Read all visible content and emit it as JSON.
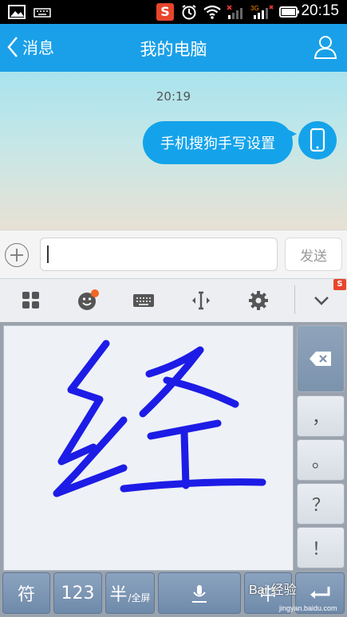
{
  "status_bar": {
    "time": "20:15",
    "icons": [
      "image-icon",
      "keyboard-icon",
      "sogou-icon",
      "alarm-icon",
      "wifi-icon",
      "signal-icon",
      "signal-3g-icon",
      "battery-icon"
    ]
  },
  "header": {
    "back_label": "消息",
    "title": "我的电脑"
  },
  "chat": {
    "timestamp": "20:19",
    "messages": [
      {
        "text": "手机搜狗手写设置"
      }
    ]
  },
  "input_bar": {
    "value": "",
    "send_label": "发送"
  },
  "keyboard_toolbar": {
    "icons": [
      "apps-icon",
      "emoji-icon",
      "keyboard-icon",
      "cursor-icon",
      "settings-icon",
      "collapse-icon"
    ]
  },
  "keyboard": {
    "handwriting_char": "经",
    "side_keys": [
      "，",
      "。",
      "？",
      "！"
    ],
    "bottom_keys": {
      "symbols": "符",
      "numbers": "123",
      "half": "半",
      "full": "/全屏",
      "lang": "中"
    }
  },
  "watermark": {
    "text": "Bai 经验",
    "url": "jingyan.baidu.com"
  },
  "colors": {
    "accent": "#1aa0e8",
    "ink": "#1c1ce6",
    "notify": "#f26522"
  }
}
